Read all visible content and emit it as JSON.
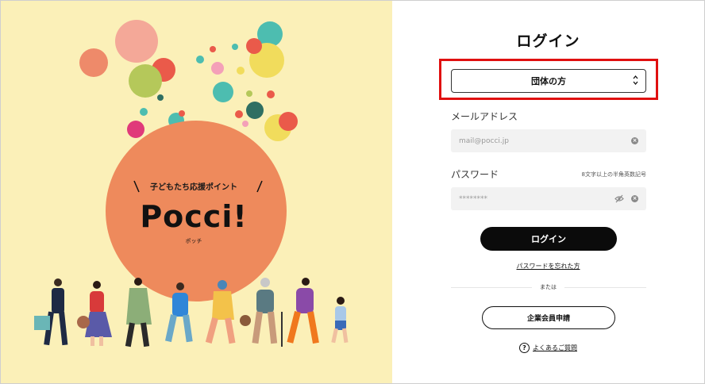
{
  "brand": {
    "subtitle": "子どもたち応援ポイント",
    "name": "Pocci!",
    "kana": "ポッチ"
  },
  "login": {
    "title": "ログイン",
    "account_type_select": "団体の方",
    "email_label": "メールアドレス",
    "email_placeholder": "mail@pocci.jp",
    "password_label": "パスワード",
    "password_hint": "8文字以上の半角英数記号",
    "password_placeholder": "********",
    "login_button": "ログイン",
    "forgot_password": "パスワードを忘れた方",
    "or_text": "または",
    "corporate_signup_button": "企業会員申請",
    "faq_link": "よくあるご質問",
    "faq_icon": "?",
    "clear_icon": "×"
  },
  "colors": {
    "left_background": "#fbf0b8",
    "main_circle": "#ee8a5c",
    "highlight": "#e01010",
    "button": "#0b0b0b"
  }
}
